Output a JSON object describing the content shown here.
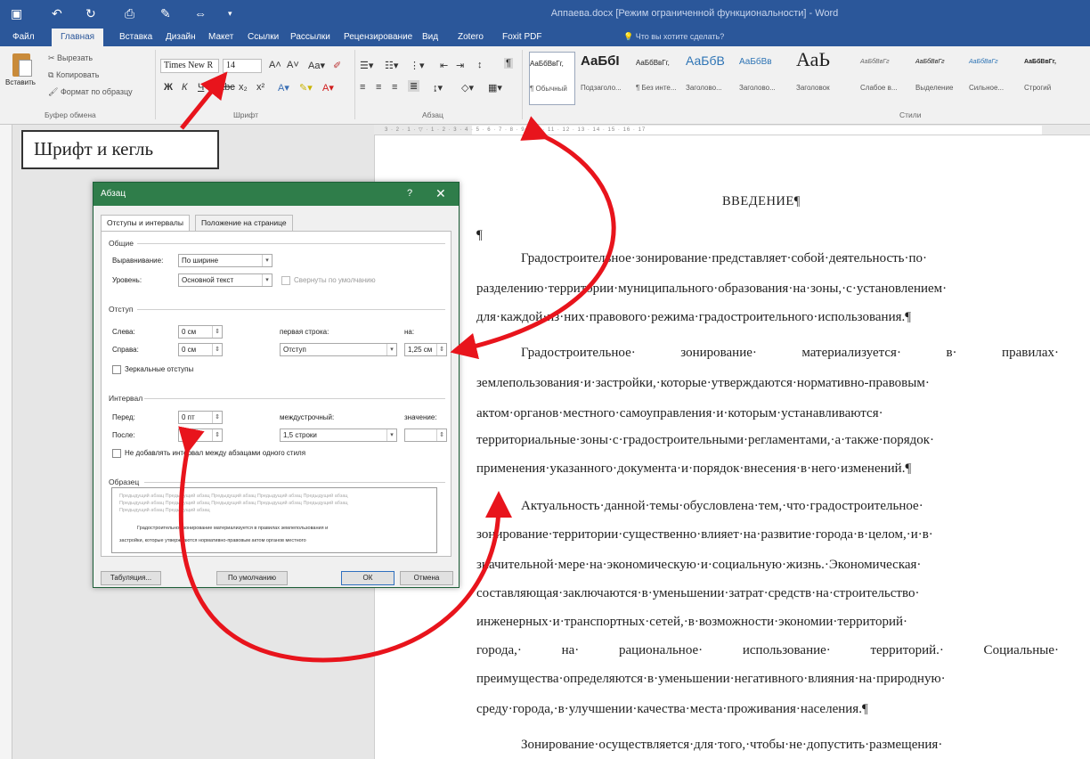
{
  "window": {
    "title": "Аппаева.docx [Режим ограниченной функциональности] - Word"
  },
  "tabs": [
    "Файл",
    "Главная",
    "Вставка",
    "Дизайн",
    "Макет",
    "Ссылки",
    "Рассылки",
    "Рецензирование",
    "Вид",
    "Zotero",
    "Foxit PDF"
  ],
  "tell_me": "Что вы хотите сделать?",
  "ribbon": {
    "paste": "Вставить",
    "cut": "Вырезать",
    "copy": "Копировать",
    "format_painter": "Формат по образцу",
    "clipboard_group": "Буфер обмена",
    "font_name": "Times New R",
    "font_size": "14",
    "font_group": "Шрифт",
    "paragraph_group": "Абзац",
    "styles_group": "Стили",
    "styles": [
      {
        "sample": "АаБбВвГг,",
        "name": "¶ Обычный"
      },
      {
        "sample": "АаБбІ",
        "name": "Подзаголо..."
      },
      {
        "sample": "АаБбВвГг,",
        "name": "¶ Без инте..."
      },
      {
        "sample": "АаБбВ",
        "name": "Заголово..."
      },
      {
        "sample": "АаБбВв",
        "name": "Заголово..."
      },
      {
        "sample": "АаЬ",
        "name": "Заголовок"
      },
      {
        "sample": "АаБбВвГг",
        "name": "Слабое в..."
      },
      {
        "sample": "АаБбВвГг",
        "name": "Выделение"
      },
      {
        "sample": "АаБбВвГг",
        "name": "Сильное..."
      },
      {
        "sample": "АаБбВвГг,",
        "name": "Строгий"
      }
    ]
  },
  "callout": "Шрифт и кегль",
  "dialog": {
    "title": "Абзац",
    "help": "?",
    "close": "✕",
    "tab_indents": "Отступы и интервалы",
    "tab_position": "Положение на странице",
    "general": "Общие",
    "alignment_label": "Выравнивание:",
    "alignment_value": "По ширине",
    "level_label": "Уровень:",
    "level_value": "Основной текст",
    "collapsed_label": "Свернуты по умолчанию",
    "indent": "Отступ",
    "left_label": "Слева:",
    "left_value": "0 см",
    "right_label": "Справа:",
    "right_value": "0 см",
    "first_line_label": "первая строка:",
    "first_line_value": "Отступ",
    "on_label": "на:",
    "on_value": "1,25 см",
    "mirror_label": "Зеркальные отступы",
    "spacing": "Интервал",
    "before_label": "Перед:",
    "before_value": "0 пт",
    "after_label": "После:",
    "after_value": "6 пт",
    "line_spacing_label": "междустрочный:",
    "line_spacing_value": "1,5 строки",
    "value_label": "значение:",
    "no_space_label": "Не добавлять интервал между абзацами одного стиля",
    "preview": "Образец",
    "preview_gray": [
      "Предыдущий абзац Предыдущий абзац Предыдущий абзац Предыдущий абзац Предыдущий абзац",
      "Предыдущий абзац Предыдущий абзац Предыдущий абзац Предыдущий абзац Предыдущий абзац",
      "Предыдущий абзац Предыдущий абзац"
    ],
    "preview_dark": [
      "Градостроительное зонирование материализуется в правилах землепользования и",
      "застройки, которые утверждаются нормативно-правовым актом органов местного"
    ],
    "btn_tabs": "Табуляция...",
    "btn_default": "По умолчанию",
    "btn_ok": "ОК",
    "btn_cancel": "Отмена"
  },
  "document": {
    "heading": "ВВЕДЕНИЕ¶",
    "pilcrow": "¶",
    "lines": [
      "Градостроительное·зонирование·представляет·собой·деятельность·по·",
      "разделению·территории·муниципального·образования·на·зоны,·с·установлением·",
      "для·каждой·из·них·правового·режима·градостроительного·использования.¶",
      "Градостроительное·  зонирование·  материализуется·  в·  правилах·",
      "землепользования·и·застройки,·которые·утверждаются·нормативно-правовым·",
      "актом·органов·местного·самоуправления·и·которым·устанавливаются·",
      "территориальные·зоны·с·градостроительными·регламентами,·а·также·порядок·",
      "применения·указанного·документа·и·порядок·внесения·в·него·изменений.¶",
      "Актуальность·данной·темы·обусловлена·тем,·что·градостроительное·",
      "зонирование·территории·существенно·влияет·на·развитие·города·в·целом,·и·в·",
      "значительной·мере·на·экономическую·и·социальную·жизнь.·Экономическая·",
      "составляющая·заключаются·в·уменьшении·затрат·средств·на·строительство·",
      "инженерных·и·транспортных·сетей,·в·возможности·экономии·территорий·",
      "города,·  на·  рациональное·  использование·  территорий.·  Социальные·",
      "преимущества·определяются·в·уменьшении·негативного·влияния·на·природную·",
      "среду·города,·в·улучшении·качества·места·проживания·населения.¶",
      "Зонирование·осуществляется·для·того,·чтобы·не·допустить·размещения·"
    ]
  },
  "colors": {
    "word_blue": "#2b579a",
    "dialog_green": "#2f7d4a",
    "arrow_red": "#e8141c"
  }
}
